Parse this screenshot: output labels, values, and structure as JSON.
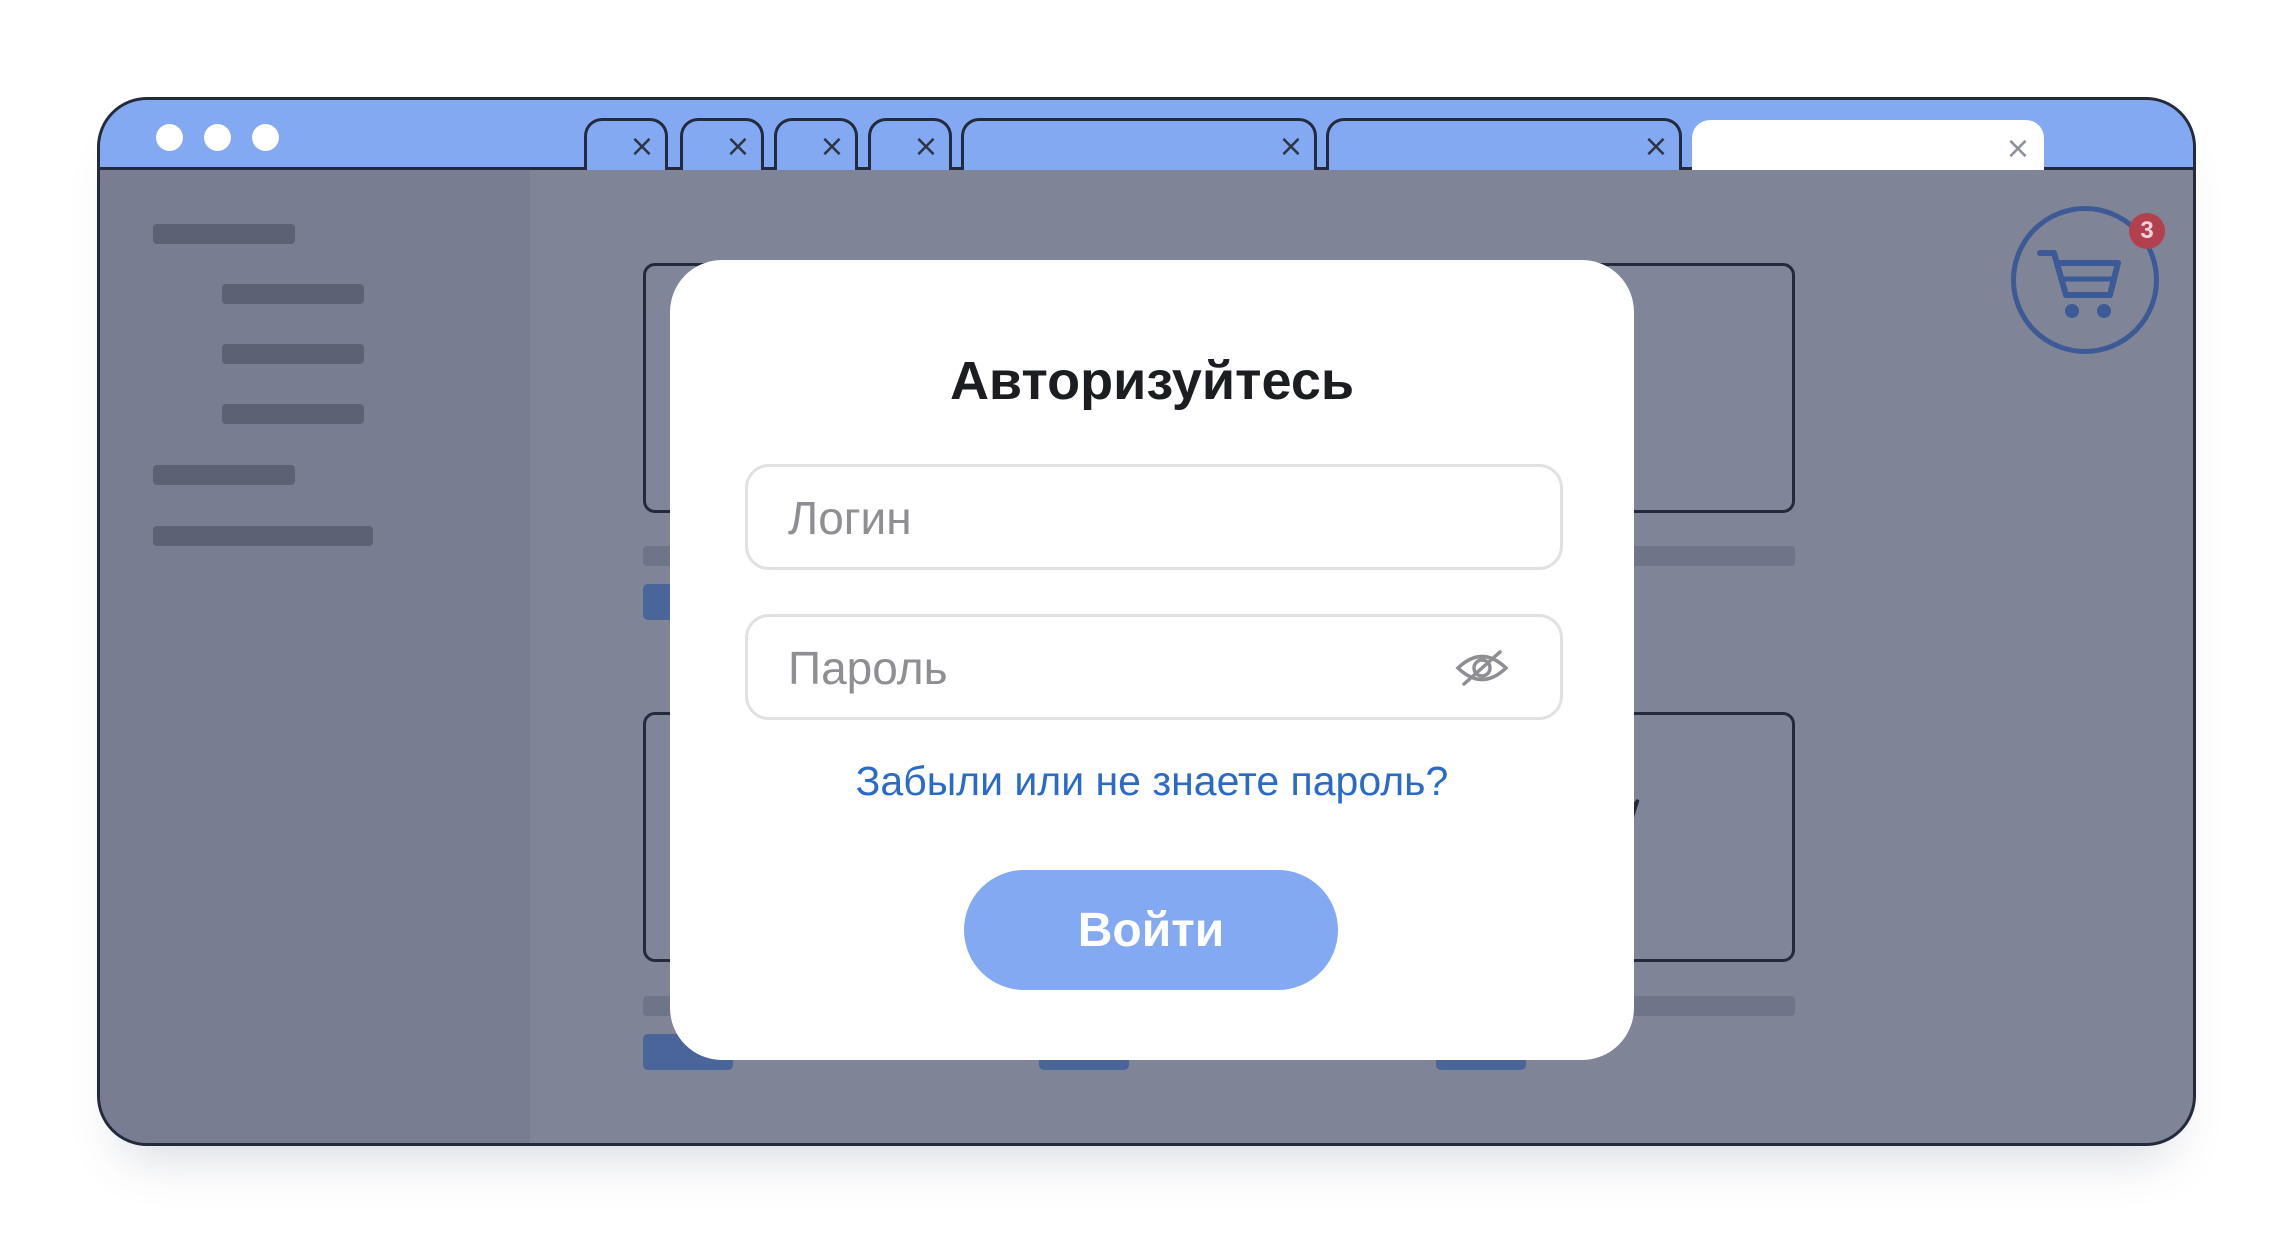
{
  "browser": {
    "tab_count": 7,
    "active_tab_index": 6,
    "tab_close_glyph": "×"
  },
  "cart": {
    "icon": "shopping-cart-icon",
    "badge_count": "3"
  },
  "login_modal": {
    "title": "Авторизуйтесь",
    "login_placeholder": "Логин",
    "password_placeholder": "Пароль",
    "password_toggle_icon": "eye-hidden-icon",
    "forgot_link": "Забыли или не знаете пароль?",
    "submit_label": "Войти"
  },
  "colors": {
    "accent": "#83a9f2",
    "link": "#2a6ac8",
    "overlay": "#7f8496",
    "badge": "#b2404d"
  }
}
